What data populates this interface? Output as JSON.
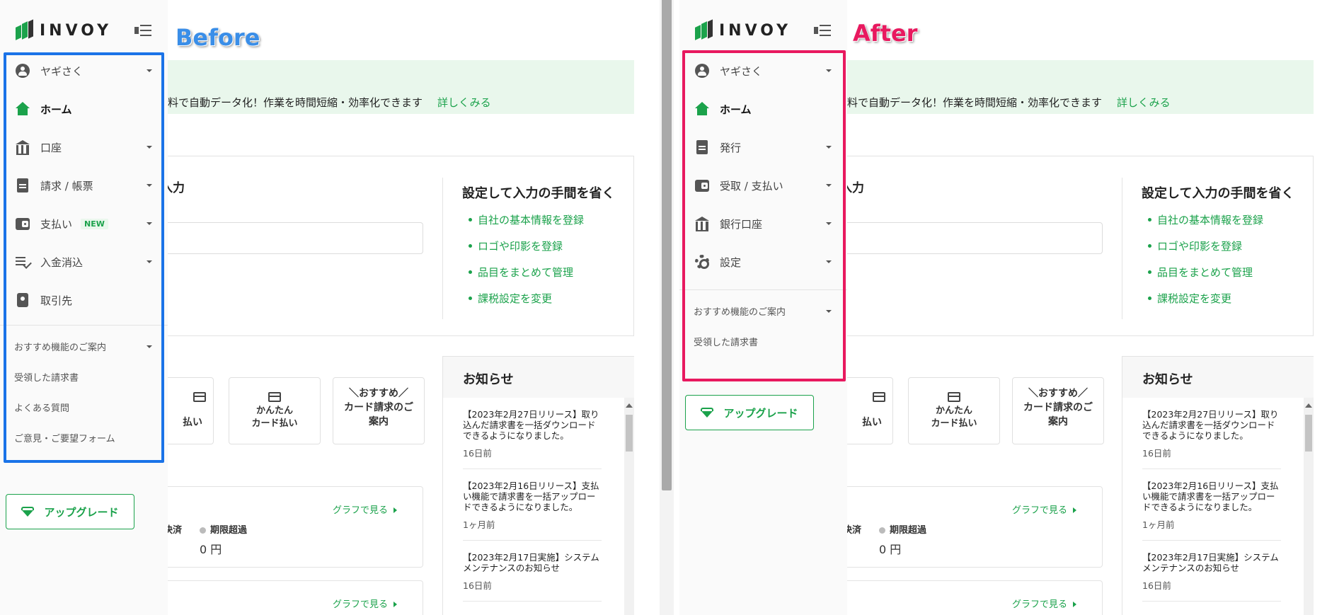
{
  "brand": {
    "logo_text": "INVOY",
    "accent": "#1ba24b"
  },
  "labels": {
    "before": "Before",
    "after": "After"
  },
  "main": {
    "banner_text": "料で自動データ化！作業を時間短縮・効率化できます",
    "banner_link": "詳しくみる",
    "input_heading": "入力",
    "settings_heading": "設定して入力の手間を省く",
    "settings_links": [
      "自社の基本情報を登録",
      "ロゴや印影を登録",
      "品目をまとめて管理",
      "課税設定を変更"
    ],
    "payment_cards": [
      {
        "label": "払い"
      },
      {
        "label_line1": "かんたん",
        "label_line2": "カード払い"
      },
      {
        "label_line1": "＼おすすめ／",
        "label_line2": "カード請求のご",
        "label_line3": "案内"
      }
    ],
    "graph_link": "グラフで見る",
    "paid_label": "決済",
    "overdue_label": "期限超過",
    "overdue_amount": "0 円",
    "news": {
      "title": "お知らせ",
      "items": [
        {
          "text": "【2023年2月27日リリース】取り込んだ請求書を一括ダウンロードできるようになりました。",
          "ago": "16日前"
        },
        {
          "text": "【2023年2月16日リリース】支払い機能で請求書を一括アップロードできるようになりました。",
          "ago": "1ヶ月前"
        },
        {
          "text": "【2023年2月17日実施】システムメンテナンスのお知らせ",
          "ago": "16日前"
        }
      ]
    }
  },
  "before_sidebar": {
    "nav": [
      {
        "label": "ヤギさく",
        "icon": "user-icon"
      },
      {
        "label": "ホーム",
        "icon": "home-icon"
      },
      {
        "label": "口座",
        "icon": "bank-icon"
      },
      {
        "label": "請求 / 帳票",
        "icon": "document-icon"
      },
      {
        "label": "支払い",
        "icon": "wallet-icon",
        "badge": "NEW"
      },
      {
        "label": "入金消込",
        "icon": "checklist-icon"
      },
      {
        "label": "取引先",
        "icon": "contacts-icon"
      }
    ],
    "sub": [
      "おすすめ機能のご案内",
      "受領した請求書",
      "よくある質問",
      "ご意見・ご要望フォーム"
    ],
    "upgrade": "アップグレード"
  },
  "after_sidebar": {
    "nav": [
      {
        "label": "ヤギさく",
        "icon": "user-icon"
      },
      {
        "label": "ホーム",
        "icon": "home-icon"
      },
      {
        "label": "発行",
        "icon": "document-icon"
      },
      {
        "label": "受取 / 支払い",
        "icon": "wallet-icon"
      },
      {
        "label": "銀行口座",
        "icon": "bank-icon"
      },
      {
        "label": "設定",
        "icon": "gear-icon"
      }
    ],
    "sub": [
      "おすすめ機能のご案内",
      "受領した請求書"
    ],
    "upgrade": "アップグレード"
  }
}
